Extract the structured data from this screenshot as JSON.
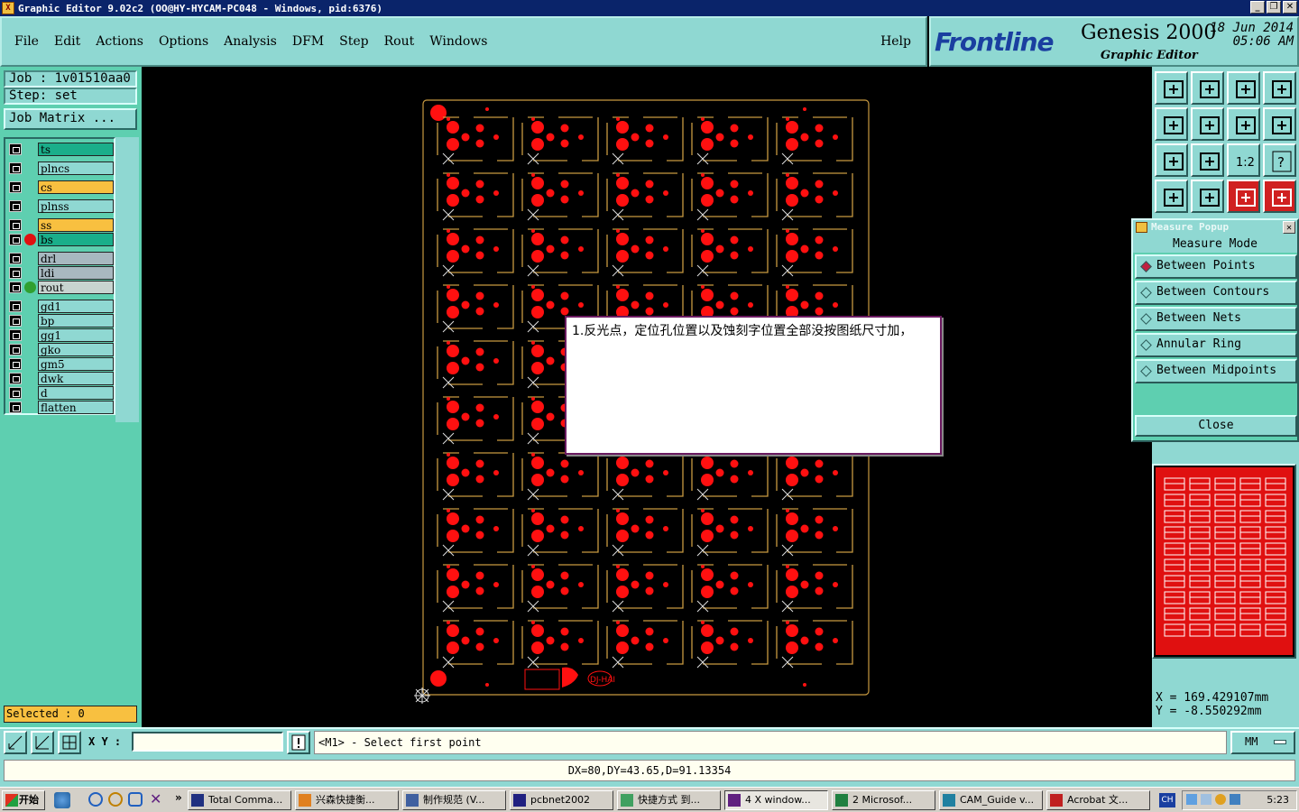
{
  "window": {
    "title": "Graphic Editor 9.02c2  (OO@HY-HYCAM-PC048 - Windows, pid:6376)",
    "app_icon_glyph": "X"
  },
  "menu": [
    "File",
    "Edit",
    "Actions",
    "Options",
    "Analysis",
    "DFM",
    "Step",
    "Rout",
    "Windows"
  ],
  "help": "Help",
  "brand": {
    "logo": "Frontline",
    "product": "Genesis 2000",
    "module": "Graphic Editor",
    "date": "18 Jun 2014",
    "time": "05:06 AM"
  },
  "job": {
    "job_label": "Job : 1v01510aa0",
    "step_label": "Step: set",
    "matrix_button": "Job Matrix ..."
  },
  "layers": [
    {
      "name": "ts",
      "color": "#1aae8a",
      "dot": ""
    },
    {
      "name": "plncs",
      "color": "#8fd8d2",
      "dot": ""
    },
    {
      "name": "cs",
      "color": "#f8c040",
      "dot": ""
    },
    {
      "name": "plnss",
      "color": "#8fd8d2",
      "dot": ""
    },
    {
      "name": "ss",
      "color": "#f8c040",
      "dot": ""
    },
    {
      "name": "bs",
      "color": "#1aae8a",
      "dot": "#e01010"
    },
    {
      "name": "drl",
      "color": "#a8b8c0",
      "dot": ""
    },
    {
      "name": "ldi",
      "color": "#a8b8c0",
      "dot": ""
    },
    {
      "name": "rout",
      "color": "#c8d4d0",
      "dot": "#30a030"
    },
    {
      "name": "gd1",
      "color": "#8fd8d2",
      "dot": ""
    },
    {
      "name": "bp",
      "color": "#8fd8d2",
      "dot": ""
    },
    {
      "name": "gg1",
      "color": "#8fd8d2",
      "dot": ""
    },
    {
      "name": "gko",
      "color": "#8fd8d2",
      "dot": ""
    },
    {
      "name": "gm5",
      "color": "#8fd8d2",
      "dot": ""
    },
    {
      "name": "dwk",
      "color": "#8fd8d2",
      "dot": ""
    },
    {
      "name": "d",
      "color": "#8fd8d2",
      "dot": ""
    },
    {
      "name": "flatten",
      "color": "#8fd8d2",
      "dot": ""
    }
  ],
  "selected": "Selected : 0",
  "measure": {
    "title": "Measure Popup",
    "header": "Measure Mode",
    "options": [
      "Between Points",
      "Between Contours",
      "Between Nets",
      "Annular Ring",
      "Between Midpoints"
    ],
    "selected_index": 0,
    "close": "Close"
  },
  "coords": {
    "x": "X  =  169.429107mm",
    "y": "Y  =  -8.550292mm"
  },
  "cmd": {
    "xy_label": "X Y :",
    "xy_value": "",
    "prompt": "<M1> - Select first point",
    "unit": "MM"
  },
  "distance": "DX=80,DY=43.65,D=91.13354",
  "note": {
    "text": "1.反光点，定位孔位置以及蚀刻字位置全部没按图纸尺寸加，"
  },
  "panel": {
    "rows": 10,
    "cols": 5,
    "marking": "DJ-HAI"
  },
  "taskbar": {
    "start": "开始",
    "items": [
      "Total Comma...",
      "兴森快捷衡...",
      "制作规范 (V...",
      "pcbnet2002",
      "快捷方式 到...",
      "4 X window...",
      "2 Microsof...",
      "CAM_Guide v...",
      "Acrobat 文..."
    ],
    "lang": "CH",
    "clock": "5:23"
  },
  "colors": {
    "pad": "#ff1010",
    "outline": "#c89a40",
    "panel_bg": "#d8fffa"
  }
}
